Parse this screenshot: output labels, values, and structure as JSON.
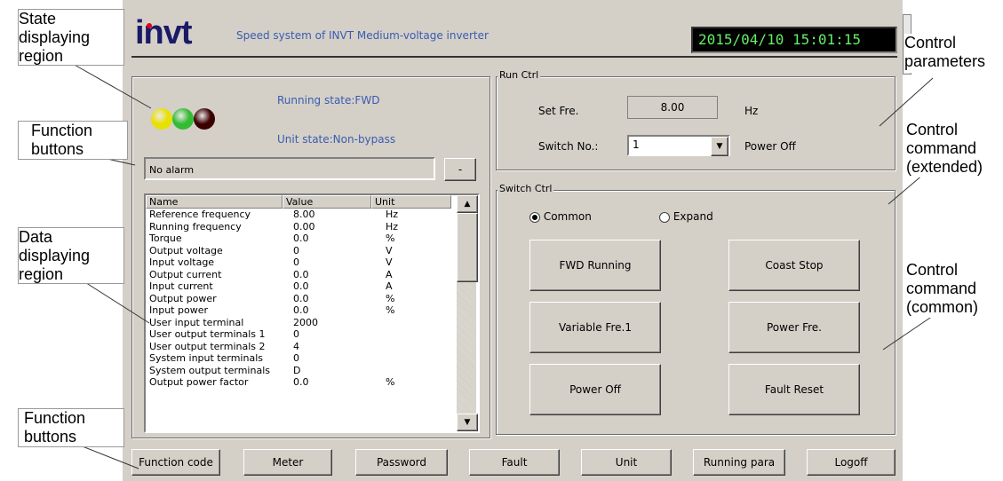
{
  "header": {
    "logo_text": "invt",
    "title": "Speed system of INVT Medium-voltage inverter",
    "datetime": "2015/04/10 15:01:15"
  },
  "state": {
    "running_state": "Running state:FWD",
    "unit_state": "Unit state:Non-bypass",
    "lamps": [
      "#e8e000",
      "#33bb33",
      "#3a0000"
    ],
    "alarm": "No alarm",
    "alarm_button": "-"
  },
  "table": {
    "columns": [
      "Name",
      "Value",
      "Unit"
    ],
    "rows": [
      [
        "Reference frequency",
        "8.00",
        "Hz"
      ],
      [
        "Running frequency",
        "0.00",
        "Hz"
      ],
      [
        "Torque",
        "0.0",
        "%"
      ],
      [
        "Output voltage",
        "0",
        "V"
      ],
      [
        "Input voltage",
        "0",
        "V"
      ],
      [
        "Output current",
        "0.0",
        "A"
      ],
      [
        "Input current",
        "0.0",
        "A"
      ],
      [
        "Output power",
        "0.0",
        "%"
      ],
      [
        "Input power",
        "0.0",
        "%"
      ],
      [
        "User input terminal",
        "2000",
        ""
      ],
      [
        "User output terminals 1",
        "0",
        ""
      ],
      [
        "User output terminals 2",
        "4",
        ""
      ],
      [
        "System input terminals",
        "0",
        ""
      ],
      [
        "System output terminals",
        "D",
        ""
      ],
      [
        "Output power factor",
        "0.0",
        "%"
      ]
    ]
  },
  "run_ctrl": {
    "title": "Run Ctrl",
    "set_fre_label": "Set Fre.",
    "set_fre_value": "8.00",
    "set_fre_unit": "Hz",
    "switch_label": "Switch No.:",
    "switch_value": "1",
    "switch_status": "Power Off"
  },
  "switch_ctrl": {
    "title": "Switch Ctrl",
    "radio_common": "Common",
    "radio_expand": "Expand",
    "buttons": [
      "FWD Running",
      "Coast Stop",
      "Variable Fre.1",
      "Power Fre.",
      "Power Off",
      "Fault Reset"
    ]
  },
  "bottom_buttons": [
    "Function code",
    "Meter",
    "Password",
    "Fault",
    "Unit",
    "Running para",
    "Logoff"
  ],
  "annotations": {
    "state": [
      "State",
      "displaying",
      "region"
    ],
    "function_top": [
      "Function",
      "buttons"
    ],
    "data": [
      "Data",
      "displaying",
      "region"
    ],
    "function_bottom": [
      "Function",
      "buttons"
    ],
    "control_params": [
      "Control",
      "parameters"
    ],
    "control_extended": [
      "Control",
      "command",
      "(extended)"
    ],
    "control_common": [
      "Control",
      "command",
      "(common)"
    ]
  }
}
